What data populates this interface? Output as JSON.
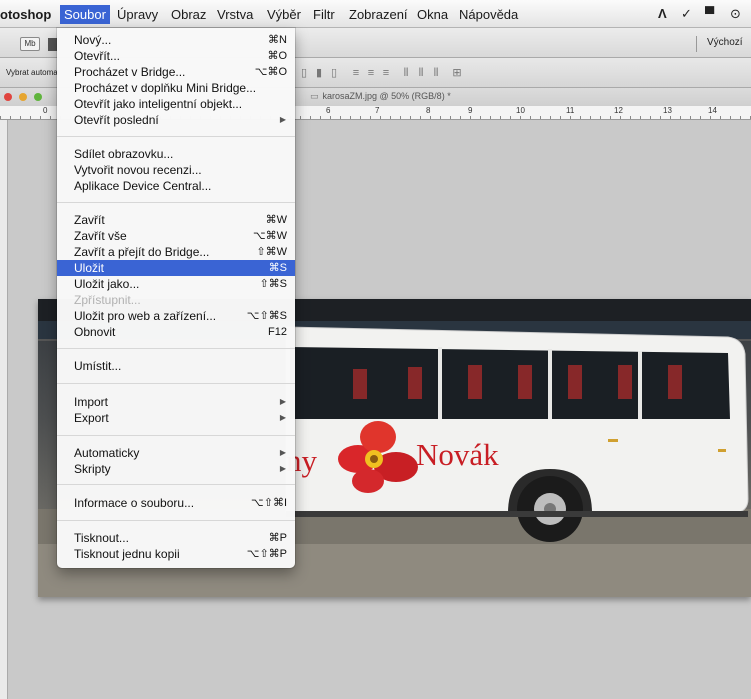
{
  "menubar": {
    "app_name": "otoshop",
    "items": [
      "Soubor",
      "Úpravy",
      "Obraz",
      "Vrstva",
      "Výběr",
      "Filtr",
      "Zobrazení",
      "Okna",
      "Nápověda"
    ],
    "active_color": "#3a64d4",
    "status_icons": [
      "adobe-icon",
      "checkmark-icon",
      "display-icon",
      "time-machine-icon"
    ]
  },
  "optionsbar": {
    "badge": "Mb",
    "workspace": "Výchozí"
  },
  "toolrow": {
    "auto_select_label": "Vybrat automa"
  },
  "document": {
    "title": "karosaZM.jpg @ 50% (RGB/8) *",
    "ruler_numbers": [
      "0",
      "6",
      "7",
      "8",
      "9",
      "10",
      "11",
      "12",
      "13",
      "14"
    ]
  },
  "photo": {
    "bus_text_left": "ny",
    "bus_text_right": "Novák"
  },
  "file_menu": {
    "items": [
      {
        "label": "Nový...",
        "shortcut": "⌘N"
      },
      {
        "label": "Otevřít...",
        "shortcut": "⌘O"
      },
      {
        "label": "Procházet v Bridge...",
        "shortcut": "⌥⌘O"
      },
      {
        "label": "Procházet v doplňku Mini Bridge...",
        "shortcut": ""
      },
      {
        "label": "Otevřít jako inteligentní objekt...",
        "shortcut": ""
      },
      {
        "label": "Otevřít poslední",
        "shortcut": "",
        "submenu": true
      },
      {
        "label": "Sdílet obrazovku...",
        "shortcut": ""
      },
      {
        "label": "Vytvořit novou recenzi...",
        "shortcut": ""
      },
      {
        "label": "Aplikace Device Central...",
        "shortcut": ""
      },
      {
        "label": "Zavřít",
        "shortcut": "⌘W"
      },
      {
        "label": "Zavřít vše",
        "shortcut": "⌥⌘W"
      },
      {
        "label": "Zavřít a přejít do Bridge...",
        "shortcut": "⇧⌘W"
      },
      {
        "label": "Uložit",
        "shortcut": "⌘S",
        "highlighted": true
      },
      {
        "label": "Uložit jako...",
        "shortcut": "⇧⌘S"
      },
      {
        "label": "Zpřístupnit...",
        "shortcut": "",
        "disabled": true
      },
      {
        "label": "Uložit pro web a zařízení...",
        "shortcut": "⌥⇧⌘S"
      },
      {
        "label": "Obnovit",
        "shortcut": "F12"
      },
      {
        "label": "Umístit...",
        "shortcut": ""
      },
      {
        "label": "Import",
        "shortcut": "",
        "submenu": true
      },
      {
        "label": "Export",
        "shortcut": "",
        "submenu": true
      },
      {
        "label": "Automaticky",
        "shortcut": "",
        "submenu": true
      },
      {
        "label": "Skripty",
        "shortcut": "",
        "submenu": true
      },
      {
        "label": "Informace o souboru...",
        "shortcut": "⌥⇧⌘I"
      },
      {
        "label": "Tisknout...",
        "shortcut": "⌘P"
      },
      {
        "label": "Tisknout jednu kopii",
        "shortcut": "⌥⇧⌘P"
      }
    ],
    "highlight_color": "#3a64d4",
    "submenu_arrow": "▶"
  }
}
